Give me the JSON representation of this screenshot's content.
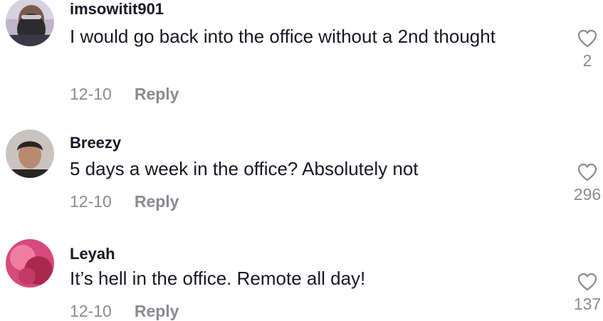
{
  "comments": [
    {
      "username": "imsowitit901",
      "text": "I would go back into the office without a 2nd thought",
      "date": "12-10",
      "reply_label": "Reply",
      "likes": "2",
      "avatar_colors": [
        "#3a3a46",
        "#8a6a5c",
        "#2b2b30"
      ]
    },
    {
      "username": "Breezy",
      "text": "5 days a week in the office? Absolutely not",
      "date": "12-10",
      "reply_label": "Reply",
      "likes": "296",
      "avatar_colors": [
        "#c9c4bf",
        "#b88a70",
        "#2a2522"
      ]
    },
    {
      "username": "Leyah",
      "text": "It’s hell in the office. Remote all day!",
      "date": "12-10",
      "reply_label": "Reply",
      "likes": "137",
      "avatar_colors": [
        "#d64a7c",
        "#a8284e",
        "#f17ca2"
      ]
    }
  ],
  "colors": {
    "text_primary": "#161823",
    "text_secondary": "#8a8b91",
    "heart_stroke": "#8a8b91"
  },
  "icons": {
    "like": "heart-outline-icon"
  }
}
